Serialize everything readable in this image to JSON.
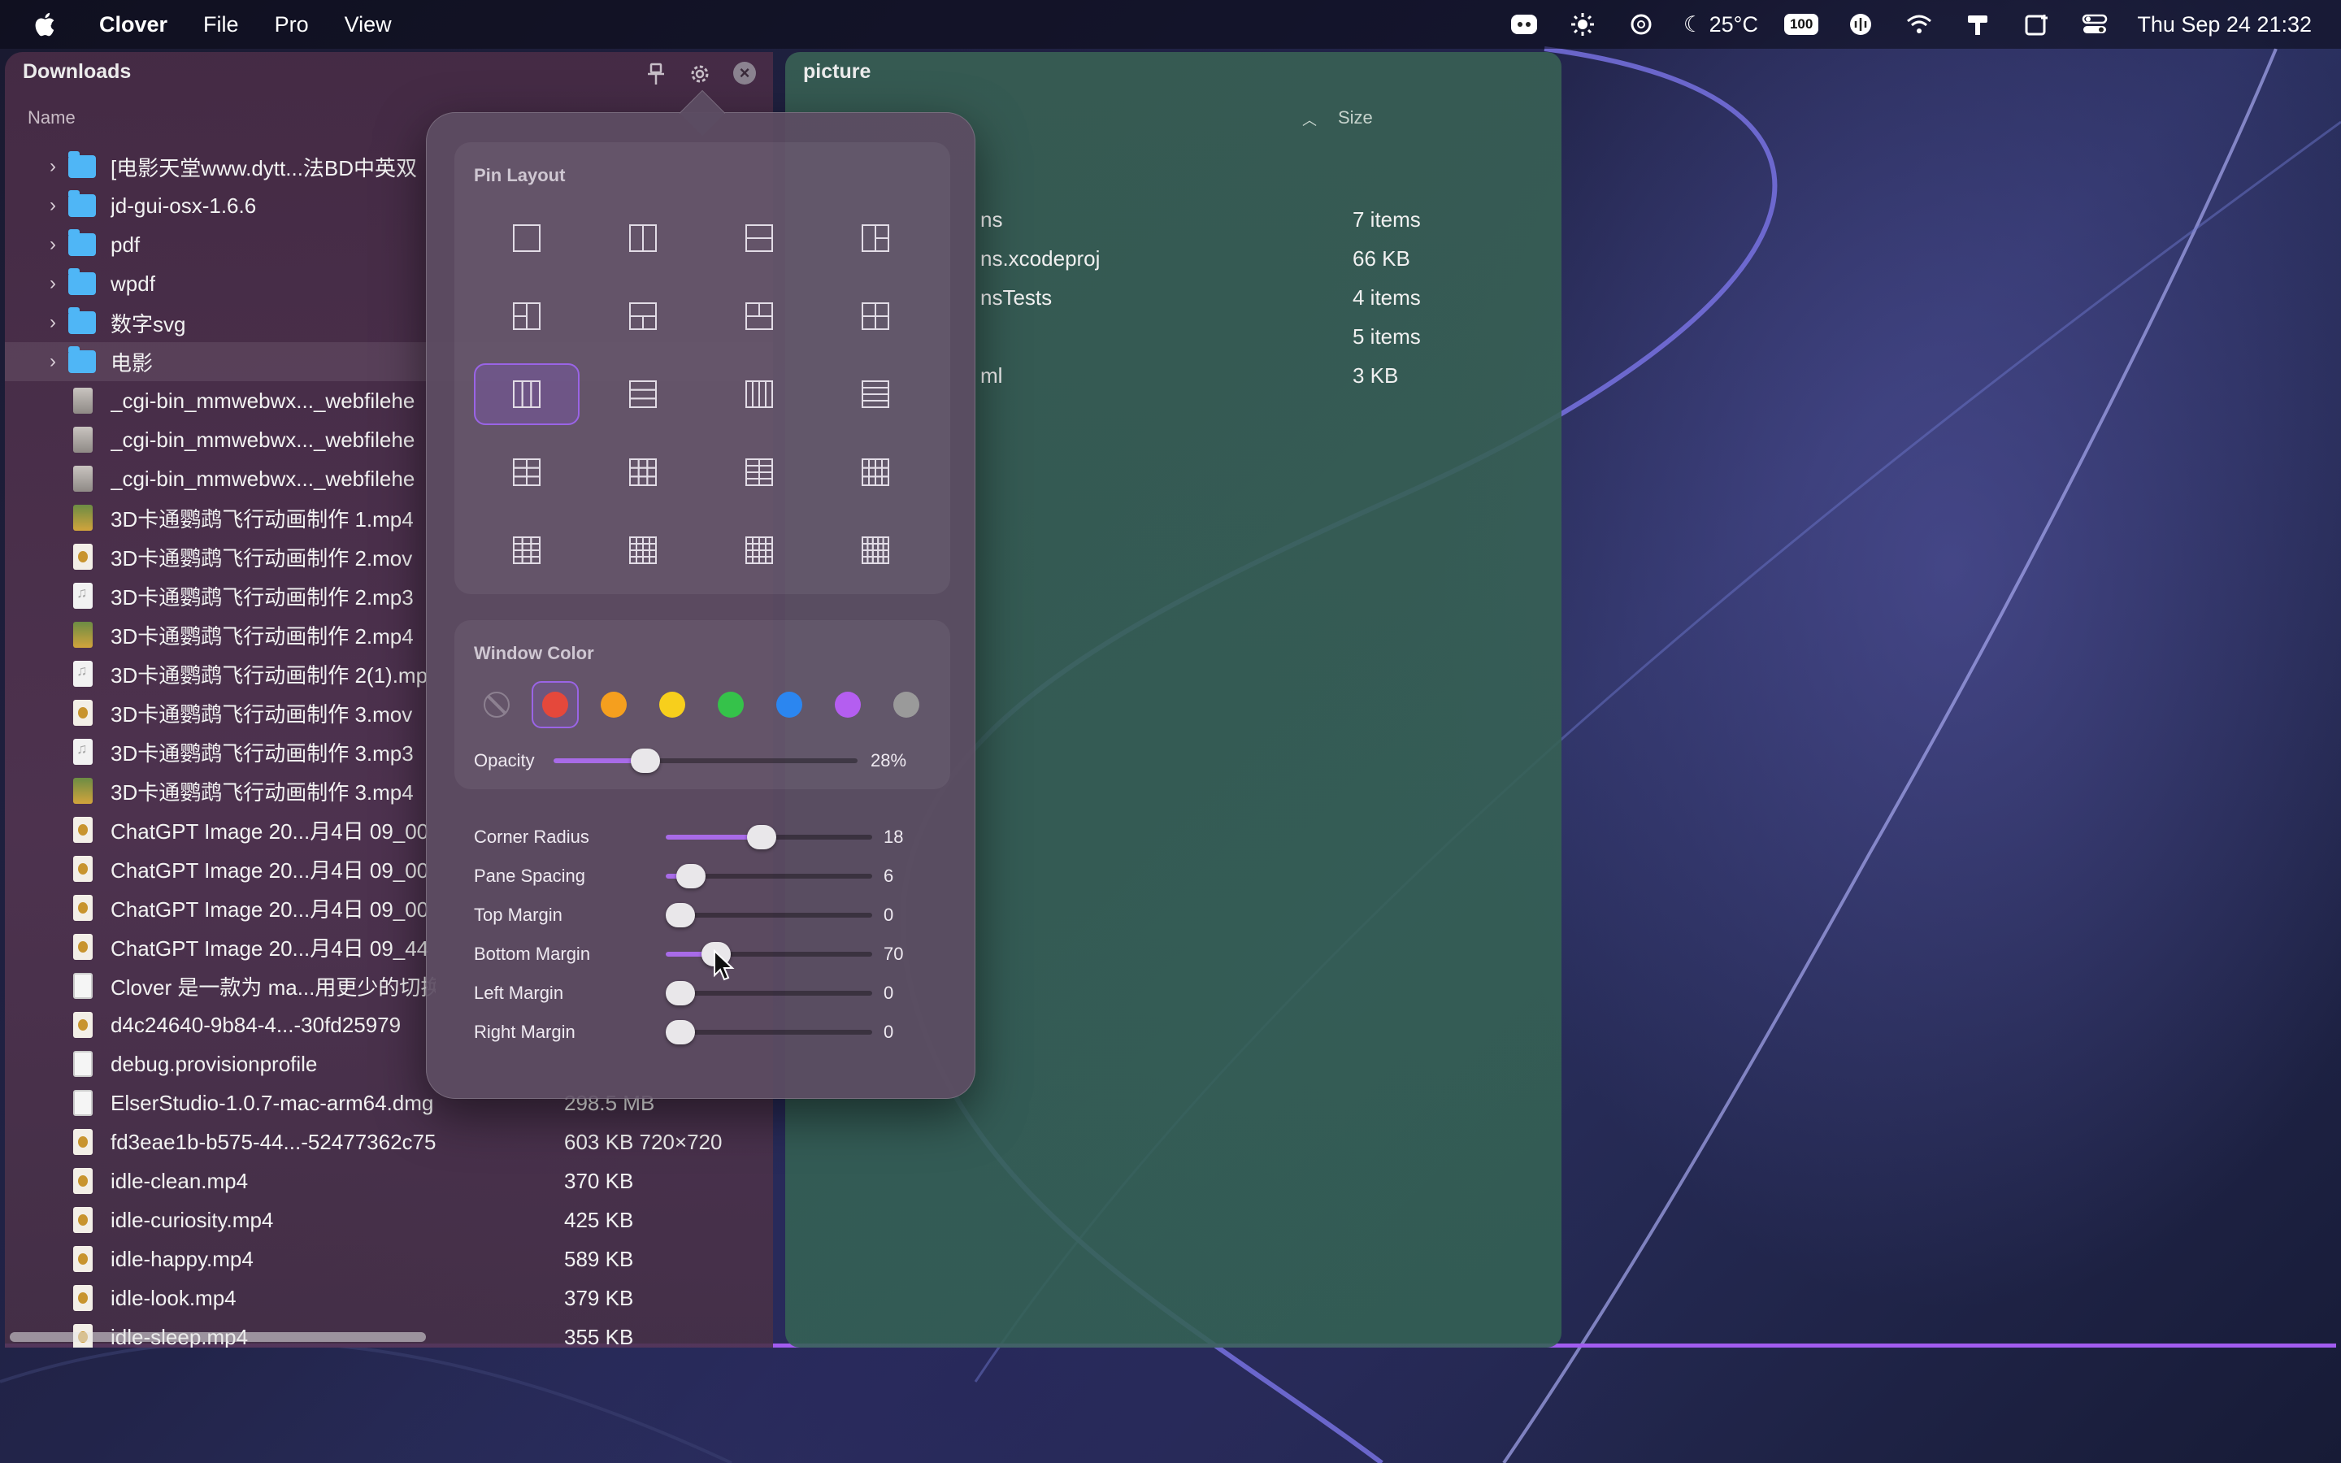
{
  "menubar": {
    "app_name": "Clover",
    "menus": [
      "File",
      "Pro",
      "View"
    ],
    "status_icons": [
      "mascot-icon",
      "brightness-icon",
      "openai-icon"
    ],
    "weather": "25°C",
    "battery": "100",
    "datetime": "Thu Sep 24  21:32"
  },
  "left_pane": {
    "title": "Downloads",
    "column_name": "Name",
    "rows": [
      {
        "name": "[电影天堂www.dytt...法BD中英双",
        "size": "",
        "kind": "folder"
      },
      {
        "name": "jd-gui-osx-1.6.6",
        "size": "",
        "kind": "folder"
      },
      {
        "name": "pdf",
        "size": "",
        "kind": "folder"
      },
      {
        "name": "wpdf",
        "size": "",
        "kind": "folder"
      },
      {
        "name": "数字svg",
        "size": "",
        "kind": "folder"
      },
      {
        "name": "电影",
        "size": "",
        "kind": "folder"
      },
      {
        "name": "_cgi-bin_mmwebwx..._webfilehe",
        "size": "",
        "kind": "img"
      },
      {
        "name": "_cgi-bin_mmwebwx..._webfilehe",
        "size": "",
        "kind": "img"
      },
      {
        "name": "_cgi-bin_mmwebwx..._webfilehe",
        "size": "",
        "kind": "img"
      },
      {
        "name": "3D卡通鹦鹉飞行动画制作 1.mp4",
        "size": "",
        "kind": "pic"
      },
      {
        "name": "3D卡通鹦鹉飞行动画制作 2.mov",
        "size": "",
        "kind": "vid"
      },
      {
        "name": "3D卡通鹦鹉飞行动画制作 2.mp3",
        "size": "",
        "kind": "aud"
      },
      {
        "name": "3D卡通鹦鹉飞行动画制作 2.mp4",
        "size": "",
        "kind": "pic"
      },
      {
        "name": "3D卡通鹦鹉飞行动画制作 2(1).mp",
        "size": "",
        "kind": "aud"
      },
      {
        "name": "3D卡通鹦鹉飞行动画制作 3.mov",
        "size": "",
        "kind": "vid"
      },
      {
        "name": "3D卡通鹦鹉飞行动画制作 3.mp3",
        "size": "",
        "kind": "aud"
      },
      {
        "name": "3D卡通鹦鹉飞行动画制作 3.mp4",
        "size": "",
        "kind": "pic"
      },
      {
        "name": "ChatGPT Image 20...月4日 09_00",
        "size": "",
        "kind": "vid"
      },
      {
        "name": "ChatGPT Image 20...月4日 09_00",
        "size": "",
        "kind": "vid"
      },
      {
        "name": "ChatGPT Image 20...月4日 09_00",
        "size": "",
        "kind": "vid"
      },
      {
        "name": "ChatGPT Image 20...月4日 09_44",
        "size": "",
        "kind": "vid"
      },
      {
        "name": "Clover 是一款为 ma...用更少的切换",
        "size": "",
        "kind": "doc"
      },
      {
        "name": "d4c24640-9b84-4...-30fd25979",
        "size": "",
        "kind": "vid"
      },
      {
        "name": "debug.provisionprofile",
        "size": "",
        "kind": "doc"
      },
      {
        "name": "ElserStudio-1.0.7-mac-arm64.dmg",
        "size": "298.5 MB",
        "kind": "doc"
      },
      {
        "name": "fd3eae1b-b575-44...-52477362c757.png",
        "size": "603 KB  720×720",
        "kind": "vid"
      },
      {
        "name": "idle-clean.mp4",
        "size": "370 KB",
        "kind": "vid"
      },
      {
        "name": "idle-curiosity.mp4",
        "size": "425 KB",
        "kind": "vid"
      },
      {
        "name": "idle-happy.mp4",
        "size": "589 KB",
        "kind": "vid"
      },
      {
        "name": "idle-look.mp4",
        "size": "379 KB",
        "kind": "vid"
      },
      {
        "name": "idle-sleep.mp4",
        "size": "355 KB",
        "kind": "vid"
      }
    ]
  },
  "right_pane": {
    "title": "picture",
    "column_size": "Size",
    "rows": [
      {
        "name": "ns",
        "size": "7 items"
      },
      {
        "name": "ns.xcodeproj",
        "size": "66 KB"
      },
      {
        "name": "nsTests",
        "size": "4 items"
      },
      {
        "name": "",
        "size": "5 items"
      },
      {
        "name": "ml",
        "size": "3 KB"
      }
    ]
  },
  "popover": {
    "pin_layout_title": "Pin Layout",
    "selected_layout_index": 8,
    "window_color_title": "Window Color",
    "colors": [
      "none",
      "#e5483b",
      "#f59f1e",
      "#f7cf1c",
      "#35c24a",
      "#2b86f0",
      "#b45ef0",
      "#9a9a9a"
    ],
    "selected_color_index": 1,
    "opacity_label": "Opacity",
    "opacity_value": "28%",
    "opacity_fraction": 0.28,
    "sliders": [
      {
        "label": "Corner Radius",
        "value": "18",
        "fraction": 0.46
      },
      {
        "label": "Pane Spacing",
        "value": "6",
        "fraction": 0.06
      },
      {
        "label": "Top Margin",
        "value": "0",
        "fraction": 0
      },
      {
        "label": "Bottom Margin",
        "value": "70",
        "fraction": 0.2
      },
      {
        "label": "Left Margin",
        "value": "0",
        "fraction": 0
      },
      {
        "label": "Right Margin",
        "value": "0",
        "fraction": 0
      }
    ]
  }
}
